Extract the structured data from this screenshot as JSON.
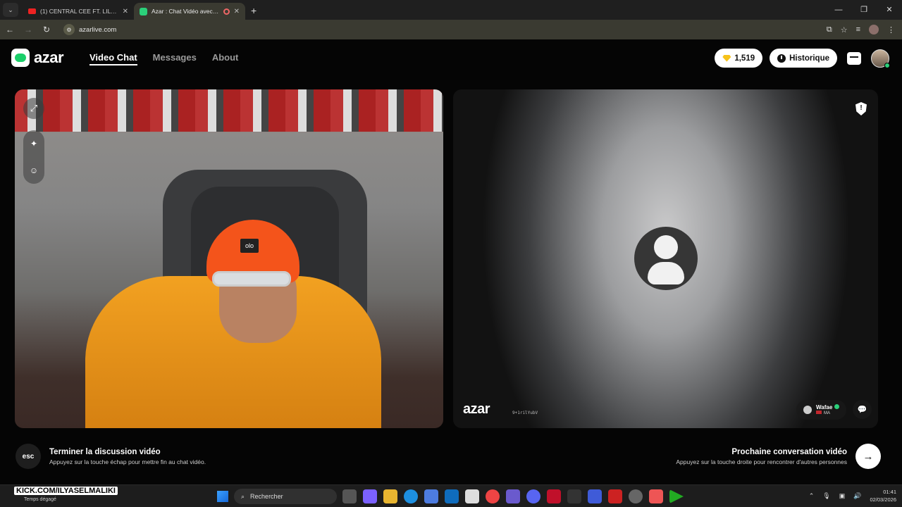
{
  "browser": {
    "tabs": [
      {
        "title": "(1) CENTRAL CEE FT. LIL BABY -",
        "active": false
      },
      {
        "title": "Azar : Chat Vidéo avec de n",
        "active": true
      }
    ],
    "url": "azarlive.com"
  },
  "header": {
    "brand": "azar",
    "nav": [
      {
        "label": "Video Chat",
        "active": true
      },
      {
        "label": "Messages",
        "active": false
      },
      {
        "label": "About",
        "active": false
      }
    ],
    "gems": "1,519",
    "history_label": "Historique"
  },
  "remote": {
    "watermark": "azar",
    "watermark_id": "9+1rilYubV",
    "partner_name": "Wafae",
    "partner_country": "MA"
  },
  "local": {
    "beanie_tag": "olo"
  },
  "footer": {
    "esc_key": "esc",
    "end_title": "Terminer la discussion vidéo",
    "end_hint": "Appuyez sur la touche échap pour mettre fin au chat vidéo.",
    "next_title": "Prochaine conversation vidéo",
    "next_hint": "Appuyez sur la touche droite pour rencontrer d'autres personnes"
  },
  "taskbar": {
    "overlay": "KICK.COM/ILYASELMALIKI",
    "weather": "Temps dégagé",
    "search_placeholder": "Rechercher",
    "time": "01:41",
    "date": "02/03/2026"
  },
  "colors": {
    "accent": "#1bcf6a",
    "gem": "#f6c21a",
    "beanie": "#f4541b",
    "jacket": "#f2a121"
  }
}
